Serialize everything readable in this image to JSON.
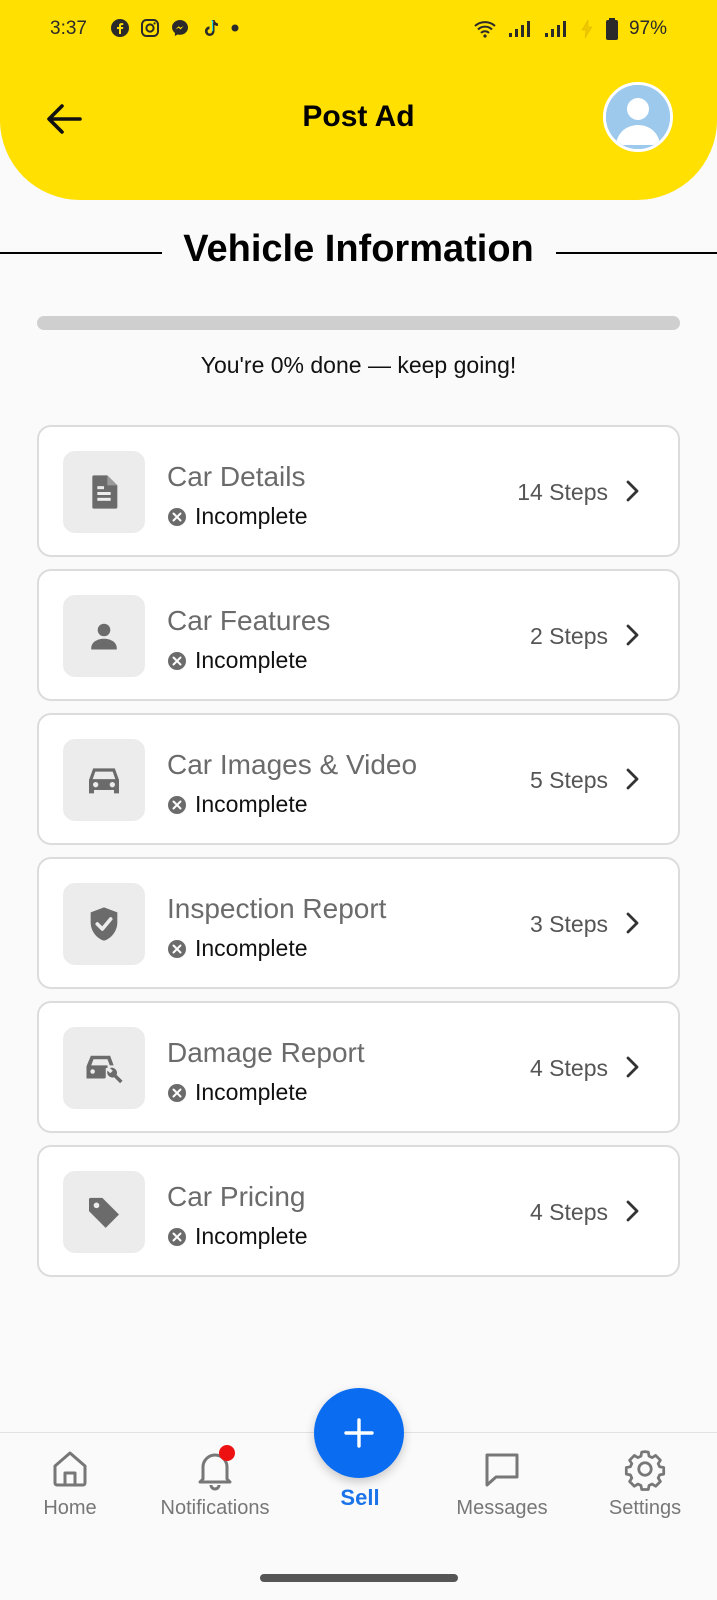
{
  "status_bar": {
    "time": "3:37",
    "battery": "97%",
    "app_icons": [
      "facebook-icon",
      "instagram-icon",
      "messenger-icon",
      "tiktok-icon",
      "dot-icon"
    ],
    "system_icons": [
      "wifi-icon",
      "signal-icon",
      "signal-icon",
      "charging-icon",
      "battery-icon"
    ]
  },
  "header": {
    "title": "Post Ad",
    "back_icon": "arrow-left-icon",
    "avatar_icon": "user-avatar-icon",
    "background_color": "#FFE000"
  },
  "section": {
    "title": "Vehicle Information"
  },
  "progress": {
    "percent": 0,
    "text": "You're 0% done — keep going!"
  },
  "cards": [
    {
      "title": "Car Details",
      "icon": "document-icon",
      "status": "Incomplete",
      "steps": "14 Steps"
    },
    {
      "title": "Car Features",
      "icon": "person-icon",
      "status": "Incomplete",
      "steps": "2 Steps"
    },
    {
      "title": "Car Images & Video",
      "icon": "car-icon",
      "status": "Incomplete",
      "steps": "5 Steps"
    },
    {
      "title": "Inspection Report",
      "icon": "shield-check-icon",
      "status": "Incomplete",
      "steps": "3 Steps"
    },
    {
      "title": "Damage Report",
      "icon": "car-wrench-icon",
      "status": "Incomplete",
      "steps": "4 Steps"
    },
    {
      "title": "Car Pricing",
      "icon": "tag-icon",
      "status": "Incomplete",
      "steps": "4 Steps"
    }
  ],
  "bottom_nav": {
    "items": [
      {
        "label": "Home",
        "icon": "home-icon"
      },
      {
        "label": "Notifications",
        "icon": "bell-icon",
        "has_badge": true
      },
      {
        "label": "Sell",
        "icon": "plus-icon",
        "active": true
      },
      {
        "label": "Messages",
        "icon": "chat-icon"
      },
      {
        "label": "Settings",
        "icon": "gear-icon"
      }
    ]
  },
  "colors": {
    "accent": "#0A6CF0",
    "header": "#FFE000",
    "badge": "#EE1111"
  }
}
